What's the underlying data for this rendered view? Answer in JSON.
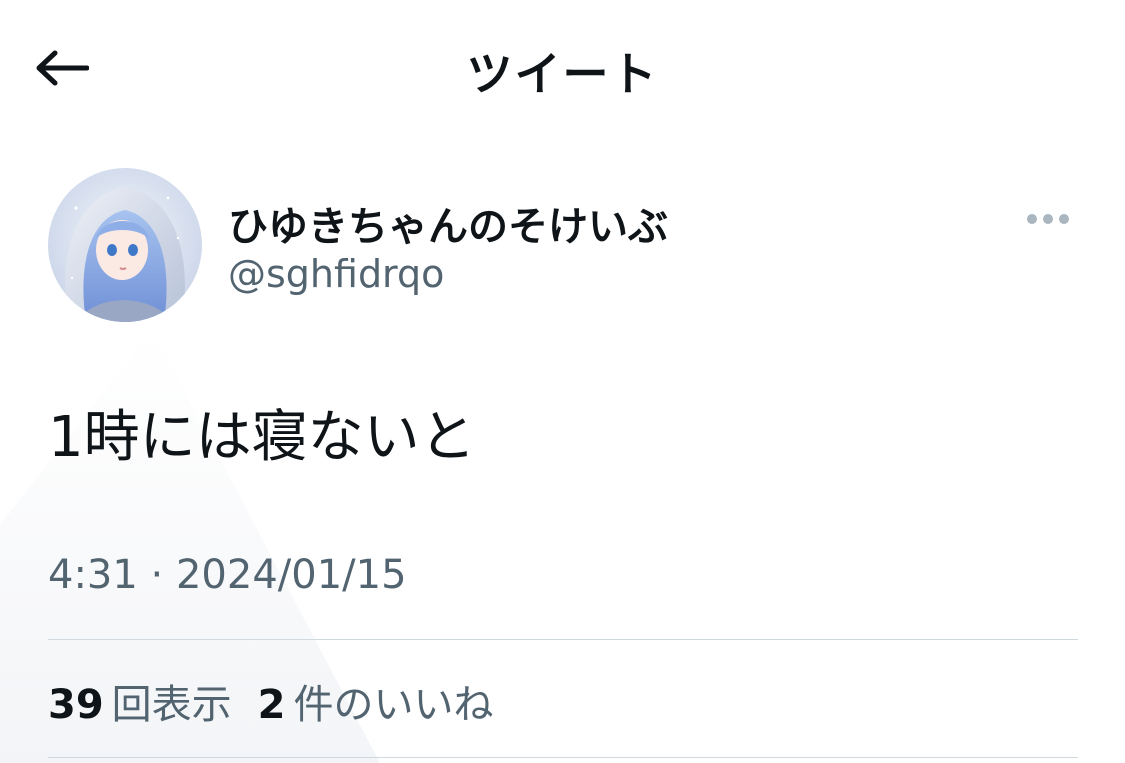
{
  "header": {
    "title": "ツイート",
    "back_icon": "arrow-left-icon"
  },
  "author": {
    "display_name": "ひゆきちゃんのそけいぶ",
    "handle": "@sghfidrqo",
    "more_icon": "more-horizontal-icon"
  },
  "tweet": {
    "text": "1時には寝ないと",
    "timestamp": "4:31 · 2024/01/15"
  },
  "stats": {
    "views_count": "39",
    "views_label": "回表示",
    "likes_count": "2",
    "likes_label": "件のいいね"
  },
  "colors": {
    "text_primary": "#0f1419",
    "text_secondary": "#536471",
    "divider": "#cfd9de",
    "more_dots": "#a9b5bf"
  }
}
